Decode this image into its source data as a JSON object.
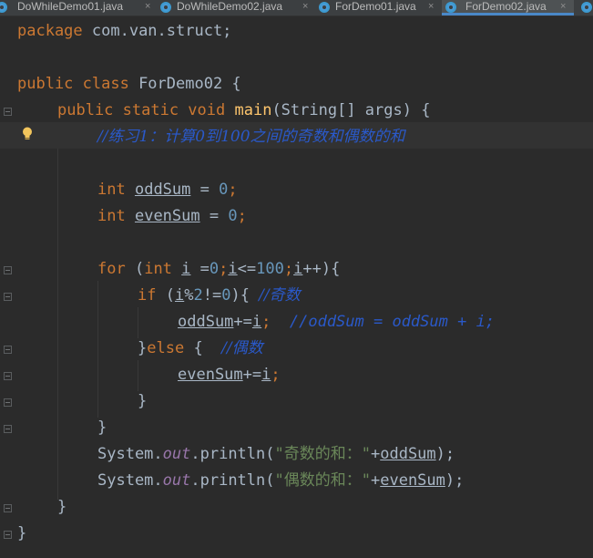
{
  "tabs": [
    {
      "label": "DoWhileDemo01.java",
      "close": "×"
    },
    {
      "label": "DoWhileDemo02.java",
      "close": "×"
    },
    {
      "label": "ForDemo01.java",
      "close": "×"
    },
    {
      "label": "ForDemo02.java",
      "close": "×",
      "active": true
    }
  ],
  "code": {
    "l1": {
      "kw": "package",
      "rest": " com.van.struct;"
    },
    "l3": {
      "kw": "public class",
      "rest": " ForDemo02 {"
    },
    "l4": {
      "kw": "public static void",
      "fn": "main",
      "rest": "(String[] args) {"
    },
    "l5": {
      "comment": "//练习1：计算0到100之间的奇数和偶数的和"
    },
    "l7": {
      "kw": "int",
      "var": "oddSum",
      "eq": " = ",
      "num": "0",
      "end": ";"
    },
    "l8": {
      "kw": "int",
      "var": "evenSum",
      "eq": " = ",
      "num": "0",
      "end": ";"
    },
    "l10": {
      "kw_for": "for",
      "p1": " (",
      "kw_int": "int",
      "i1": "i",
      "p2": " =",
      "n0": "0",
      "semi1": ";",
      "i2": "i",
      "lt": "<=",
      "n100": "100",
      "semi2": ";",
      "i3": "i",
      "pp": "++){"
    },
    "l11": {
      "kw_if": "if",
      "p1": " (",
      "i": "i",
      "mod": "%",
      "n2": "2",
      "ne": "!=",
      "n0": "0",
      "p2": "){ ",
      "comment": "//奇数"
    },
    "l12": {
      "var": "oddSum",
      "op": "+=",
      "i": "i",
      "semi": ";  ",
      "comment": "//oddSum = oddSum + i;"
    },
    "l13": {
      "brace": "}",
      "kw": "else",
      "p": " {  ",
      "comment": "//偶数"
    },
    "l14": {
      "var": "evenSum",
      "op": "+=",
      "i": "i",
      "semi": ";"
    },
    "l15": {
      "text": "}"
    },
    "l16": {
      "text": "}"
    },
    "l17": {
      "cls": "System.",
      "fld": "out",
      "call": ".println(",
      "str": "\"奇数的和：\"",
      "plus": "+",
      "var": "oddSum",
      "end": ");"
    },
    "l18": {
      "cls": "System.",
      "fld": "out",
      "call": ".println(",
      "str": "\"偶数的和：\"",
      "plus": "+",
      "var": "evenSum",
      "end": ");"
    },
    "l19": {
      "text": "}"
    },
    "l20": {
      "text": "}"
    }
  },
  "colors": {
    "background": "#2b2b2b",
    "keyword": "#cc7832",
    "function": "#ffc66d",
    "number": "#6897bb",
    "string": "#6a8759",
    "comment": "#2a59c9",
    "field": "#9876aa",
    "text": "#a9b7c6"
  },
  "icons": [
    "java-class-icon",
    "lightbulb-icon",
    "fold-marker-icon"
  ]
}
